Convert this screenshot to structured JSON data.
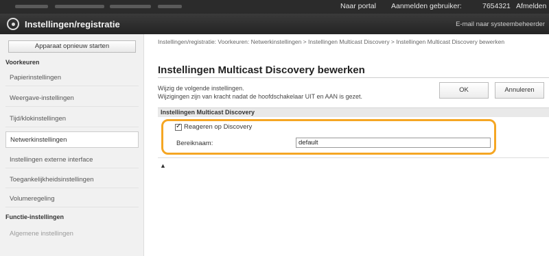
{
  "topbar": {
    "portal_label": "Naar portal",
    "login_label": "Aanmelden gebruiker:",
    "user_id": "7654321",
    "logout_label": "Afmelden"
  },
  "header": {
    "app_title": "Instellingen/registratie",
    "mail_admin": "E-mail naar systeembeheerder"
  },
  "sidebar": {
    "restart_button": "Apparaat opnieuw starten",
    "section_preferences": "Voorkeuren",
    "items": [
      {
        "label": "Papierinstellingen"
      },
      {
        "label": "Weergave-instellingen"
      },
      {
        "label": "Tijd/klokinstellingen"
      },
      {
        "label": "Netwerkinstellingen"
      },
      {
        "label": "Instellingen externe interface"
      },
      {
        "label": "Toegankelijkheidsinstellingen"
      },
      {
        "label": "Volumeregeling"
      }
    ],
    "section_functions": "Functie-instellingen",
    "function_items": [
      {
        "label": "Algemene instellingen"
      }
    ]
  },
  "main": {
    "breadcrumb": "Instellingen/registratie: Voorkeuren: Netwerkinstellingen > Instellingen Multicast Discovery > Instellingen Multicast Discovery bewerken",
    "page_title": "Instellingen Multicast Discovery bewerken",
    "description_1": "Wijzig de volgende instellingen.",
    "description_2": "Wijzigingen zijn van kracht nadat de hoofdschakelaar UIT en AAN is gezet.",
    "ok_button": "OK",
    "cancel_button": "Annuleren",
    "section_title": "Instellingen Multicast Discovery",
    "respond_checkbox_label": "Reageren op Discovery",
    "respond_checked": true,
    "scope_label": "Bereiknaam:",
    "scope_value": "default",
    "back_to_top": "▲"
  },
  "colors": {
    "highlight": "#f5a623",
    "header_bg": "#2b2b2b"
  }
}
